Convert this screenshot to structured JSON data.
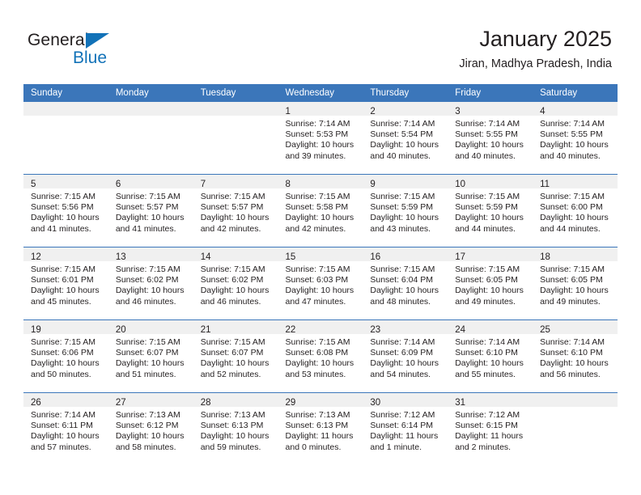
{
  "brand": {
    "word_one": "General",
    "word_two": "Blue",
    "accent_color": "#1272b8"
  },
  "header": {
    "title": "January 2025",
    "subtitle": "Jiran, Madhya Pradesh, India",
    "header_color": "#3b76ba"
  },
  "calendar": {
    "weekday_headers": [
      "Sunday",
      "Monday",
      "Tuesday",
      "Wednesday",
      "Thursday",
      "Friday",
      "Saturday"
    ],
    "weeks": [
      [
        {
          "day": "",
          "sunrise": "",
          "sunset": "",
          "daylight_a": "",
          "daylight_b": ""
        },
        {
          "day": "",
          "sunrise": "",
          "sunset": "",
          "daylight_a": "",
          "daylight_b": ""
        },
        {
          "day": "",
          "sunrise": "",
          "sunset": "",
          "daylight_a": "",
          "daylight_b": ""
        },
        {
          "day": "1",
          "sunrise": "Sunrise: 7:14 AM",
          "sunset": "Sunset: 5:53 PM",
          "daylight_a": "Daylight: 10 hours",
          "daylight_b": "and 39 minutes."
        },
        {
          "day": "2",
          "sunrise": "Sunrise: 7:14 AM",
          "sunset": "Sunset: 5:54 PM",
          "daylight_a": "Daylight: 10 hours",
          "daylight_b": "and 40 minutes."
        },
        {
          "day": "3",
          "sunrise": "Sunrise: 7:14 AM",
          "sunset": "Sunset: 5:55 PM",
          "daylight_a": "Daylight: 10 hours",
          "daylight_b": "and 40 minutes."
        },
        {
          "day": "4",
          "sunrise": "Sunrise: 7:14 AM",
          "sunset": "Sunset: 5:55 PM",
          "daylight_a": "Daylight: 10 hours",
          "daylight_b": "and 40 minutes."
        }
      ],
      [
        {
          "day": "5",
          "sunrise": "Sunrise: 7:15 AM",
          "sunset": "Sunset: 5:56 PM",
          "daylight_a": "Daylight: 10 hours",
          "daylight_b": "and 41 minutes."
        },
        {
          "day": "6",
          "sunrise": "Sunrise: 7:15 AM",
          "sunset": "Sunset: 5:57 PM",
          "daylight_a": "Daylight: 10 hours",
          "daylight_b": "and 41 minutes."
        },
        {
          "day": "7",
          "sunrise": "Sunrise: 7:15 AM",
          "sunset": "Sunset: 5:57 PM",
          "daylight_a": "Daylight: 10 hours",
          "daylight_b": "and 42 minutes."
        },
        {
          "day": "8",
          "sunrise": "Sunrise: 7:15 AM",
          "sunset": "Sunset: 5:58 PM",
          "daylight_a": "Daylight: 10 hours",
          "daylight_b": "and 42 minutes."
        },
        {
          "day": "9",
          "sunrise": "Sunrise: 7:15 AM",
          "sunset": "Sunset: 5:59 PM",
          "daylight_a": "Daylight: 10 hours",
          "daylight_b": "and 43 minutes."
        },
        {
          "day": "10",
          "sunrise": "Sunrise: 7:15 AM",
          "sunset": "Sunset: 5:59 PM",
          "daylight_a": "Daylight: 10 hours",
          "daylight_b": "and 44 minutes."
        },
        {
          "day": "11",
          "sunrise": "Sunrise: 7:15 AM",
          "sunset": "Sunset: 6:00 PM",
          "daylight_a": "Daylight: 10 hours",
          "daylight_b": "and 44 minutes."
        }
      ],
      [
        {
          "day": "12",
          "sunrise": "Sunrise: 7:15 AM",
          "sunset": "Sunset: 6:01 PM",
          "daylight_a": "Daylight: 10 hours",
          "daylight_b": "and 45 minutes."
        },
        {
          "day": "13",
          "sunrise": "Sunrise: 7:15 AM",
          "sunset": "Sunset: 6:02 PM",
          "daylight_a": "Daylight: 10 hours",
          "daylight_b": "and 46 minutes."
        },
        {
          "day": "14",
          "sunrise": "Sunrise: 7:15 AM",
          "sunset": "Sunset: 6:02 PM",
          "daylight_a": "Daylight: 10 hours",
          "daylight_b": "and 46 minutes."
        },
        {
          "day": "15",
          "sunrise": "Sunrise: 7:15 AM",
          "sunset": "Sunset: 6:03 PM",
          "daylight_a": "Daylight: 10 hours",
          "daylight_b": "and 47 minutes."
        },
        {
          "day": "16",
          "sunrise": "Sunrise: 7:15 AM",
          "sunset": "Sunset: 6:04 PM",
          "daylight_a": "Daylight: 10 hours",
          "daylight_b": "and 48 minutes."
        },
        {
          "day": "17",
          "sunrise": "Sunrise: 7:15 AM",
          "sunset": "Sunset: 6:05 PM",
          "daylight_a": "Daylight: 10 hours",
          "daylight_b": "and 49 minutes."
        },
        {
          "day": "18",
          "sunrise": "Sunrise: 7:15 AM",
          "sunset": "Sunset: 6:05 PM",
          "daylight_a": "Daylight: 10 hours",
          "daylight_b": "and 49 minutes."
        }
      ],
      [
        {
          "day": "19",
          "sunrise": "Sunrise: 7:15 AM",
          "sunset": "Sunset: 6:06 PM",
          "daylight_a": "Daylight: 10 hours",
          "daylight_b": "and 50 minutes."
        },
        {
          "day": "20",
          "sunrise": "Sunrise: 7:15 AM",
          "sunset": "Sunset: 6:07 PM",
          "daylight_a": "Daylight: 10 hours",
          "daylight_b": "and 51 minutes."
        },
        {
          "day": "21",
          "sunrise": "Sunrise: 7:15 AM",
          "sunset": "Sunset: 6:07 PM",
          "daylight_a": "Daylight: 10 hours",
          "daylight_b": "and 52 minutes."
        },
        {
          "day": "22",
          "sunrise": "Sunrise: 7:15 AM",
          "sunset": "Sunset: 6:08 PM",
          "daylight_a": "Daylight: 10 hours",
          "daylight_b": "and 53 minutes."
        },
        {
          "day": "23",
          "sunrise": "Sunrise: 7:14 AM",
          "sunset": "Sunset: 6:09 PM",
          "daylight_a": "Daylight: 10 hours",
          "daylight_b": "and 54 minutes."
        },
        {
          "day": "24",
          "sunrise": "Sunrise: 7:14 AM",
          "sunset": "Sunset: 6:10 PM",
          "daylight_a": "Daylight: 10 hours",
          "daylight_b": "and 55 minutes."
        },
        {
          "day": "25",
          "sunrise": "Sunrise: 7:14 AM",
          "sunset": "Sunset: 6:10 PM",
          "daylight_a": "Daylight: 10 hours",
          "daylight_b": "and 56 minutes."
        }
      ],
      [
        {
          "day": "26",
          "sunrise": "Sunrise: 7:14 AM",
          "sunset": "Sunset: 6:11 PM",
          "daylight_a": "Daylight: 10 hours",
          "daylight_b": "and 57 minutes."
        },
        {
          "day": "27",
          "sunrise": "Sunrise: 7:13 AM",
          "sunset": "Sunset: 6:12 PM",
          "daylight_a": "Daylight: 10 hours",
          "daylight_b": "and 58 minutes."
        },
        {
          "day": "28",
          "sunrise": "Sunrise: 7:13 AM",
          "sunset": "Sunset: 6:13 PM",
          "daylight_a": "Daylight: 10 hours",
          "daylight_b": "and 59 minutes."
        },
        {
          "day": "29",
          "sunrise": "Sunrise: 7:13 AM",
          "sunset": "Sunset: 6:13 PM",
          "daylight_a": "Daylight: 11 hours",
          "daylight_b": "and 0 minutes."
        },
        {
          "day": "30",
          "sunrise": "Sunrise: 7:12 AM",
          "sunset": "Sunset: 6:14 PM",
          "daylight_a": "Daylight: 11 hours",
          "daylight_b": "and 1 minute."
        },
        {
          "day": "31",
          "sunrise": "Sunrise: 7:12 AM",
          "sunset": "Sunset: 6:15 PM",
          "daylight_a": "Daylight: 11 hours",
          "daylight_b": "and 2 minutes."
        },
        {
          "day": "",
          "sunrise": "",
          "sunset": "",
          "daylight_a": "",
          "daylight_b": ""
        }
      ]
    ]
  }
}
